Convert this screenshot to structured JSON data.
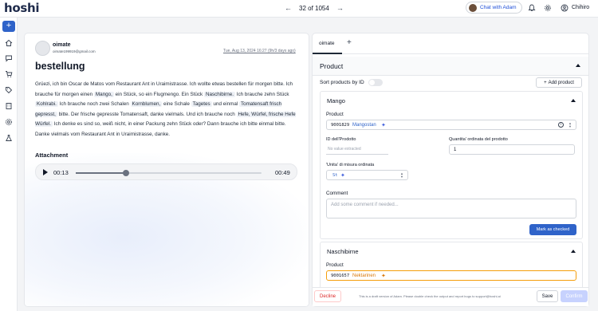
{
  "app": {
    "logo": "hoshi",
    "user_name": "Chihiro"
  },
  "pager": {
    "prev_icon": "arrow-left-icon",
    "label": "32 of 1054",
    "next_icon": "arrow-right-icon"
  },
  "chat": {
    "label": "Chat with Adam"
  },
  "header_icons": [
    "bell-icon",
    "gear-icon",
    "user-circle-icon"
  ],
  "sidebar": {
    "items": [
      "plus-icon",
      "home-icon",
      "chat-icon",
      "cart-icon",
      "tag-icon",
      "building-icon",
      "settings-icon",
      "flask-icon"
    ]
  },
  "message": {
    "sender_name": "oimate",
    "sender_email": "oimate199919@gmail.com",
    "date": "Tue, Aug 13, 2024 16:27 (9h/3 days ago)",
    "subject": "bestellung",
    "body": {
      "p1": "Grüezi, ich bin Oscar de Matos vom Restaurant Ant in Uraimistrasse. Ich wollte etwas bestellen für morgen bitte. Ich brauche für morgen einen",
      "h1": "Mango,",
      "p2": "ein Stück, so ein Flugmengo. Ein Stück",
      "h2": "Naschibirne.",
      "p3": "Ich brauche zehn Stück",
      "h3": "Kohlrabi.",
      "p4": "Ich brauche noch zwei Schalen",
      "h4": "Kornblumen,",
      "p5": "eine Schale",
      "h5": "Tagetes",
      "p6": "und einmal",
      "h6": "Tomatensaft frisch gepresst,",
      "p7": "bitte. Der frische gepresste Tomatensaft, danke vielmals. Und ich brauche noch",
      "h7": "Hefe, Würfel, frische Hefe Würfel.",
      "p8": "Ich denke es sind so, weiß nicht, in einer Packung zehn Stück oder? Dann brauche ich bitte einmal bitte. Danke vielmals vom Restaurant Ant in Uraimistrasse, danke."
    },
    "attachment_label": "Attachment",
    "audio": {
      "current": "00:13",
      "total": "00:49",
      "progress": 0.27
    }
  },
  "panel": {
    "tab_label": "oimate",
    "section_title": "Product",
    "sort_label": "Sort products by ID",
    "sort_enabled": false,
    "add_product_label": "Add product",
    "items": [
      {
        "title": "Mango",
        "product_label": "Product",
        "product_code": "9001829",
        "product_name": "Mangostan",
        "id_label": "ID dell'Prodotto",
        "id_placeholder": "No value extracted",
        "qty_label": "Quantita' ordinata del prodotto",
        "qty_value": "1",
        "unit_label": "'Unita' di misura ordinata",
        "unit_value": "St",
        "comment_label": "Comment",
        "comment_placeholder": "Add some comment if needed...",
        "mark_label": "Mark as checked"
      },
      {
        "title": "Naschibirne",
        "product_label": "Product",
        "product_code": "9001657",
        "product_name": "Nektarinen"
      }
    ],
    "footer": {
      "decline_label": "Decline",
      "note": "This is a draft version of Adam. Please double check the output and report bugs to support@hoshi.ai",
      "save_label": "Save",
      "confirm_label": "Confirm"
    }
  },
  "colors": {
    "accent": "#2f63c9",
    "danger": "#dc2626",
    "warning_border": "#f59e0b"
  }
}
